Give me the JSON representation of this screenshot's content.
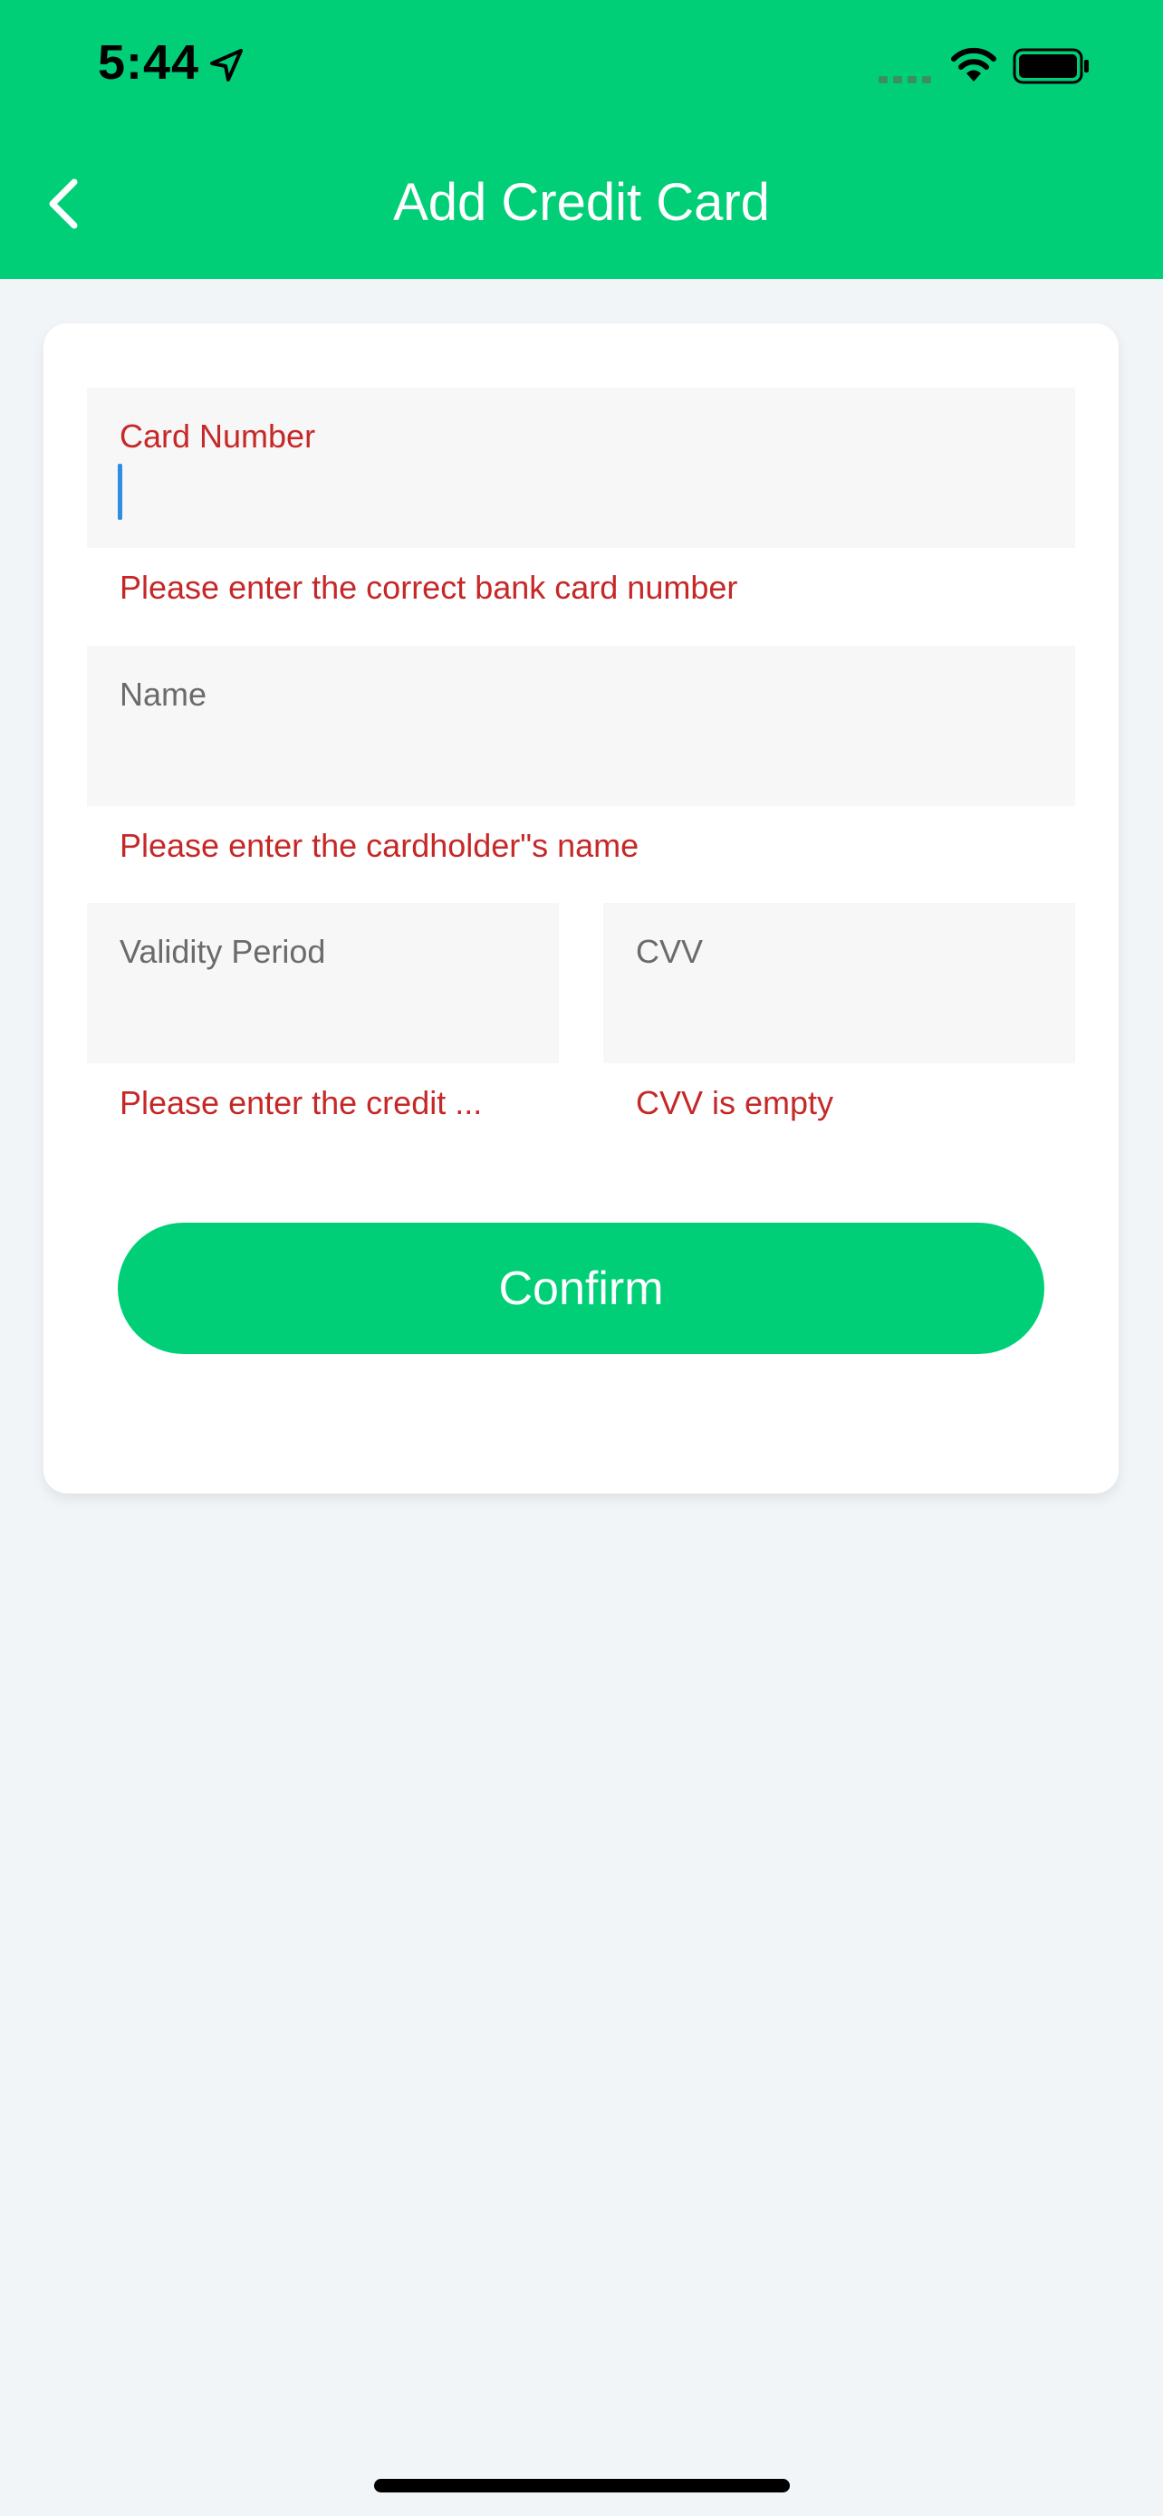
{
  "status_bar": {
    "time": "5:44"
  },
  "nav": {
    "title": "Add Credit Card"
  },
  "form": {
    "card_number": {
      "label": "Card Number",
      "error": "Please enter the correct bank card number"
    },
    "name": {
      "label": "Name",
      "error": "Please enter the cardholder\"s name"
    },
    "validity": {
      "label": "Validity Period",
      "error": "Please enter the credit ..."
    },
    "cvv": {
      "label": "CVV",
      "error": "CVV is empty"
    },
    "confirm_label": "Confirm"
  },
  "colors": {
    "accent": "#00cf78",
    "error": "#c62828",
    "caret": "#2f8ee0"
  }
}
